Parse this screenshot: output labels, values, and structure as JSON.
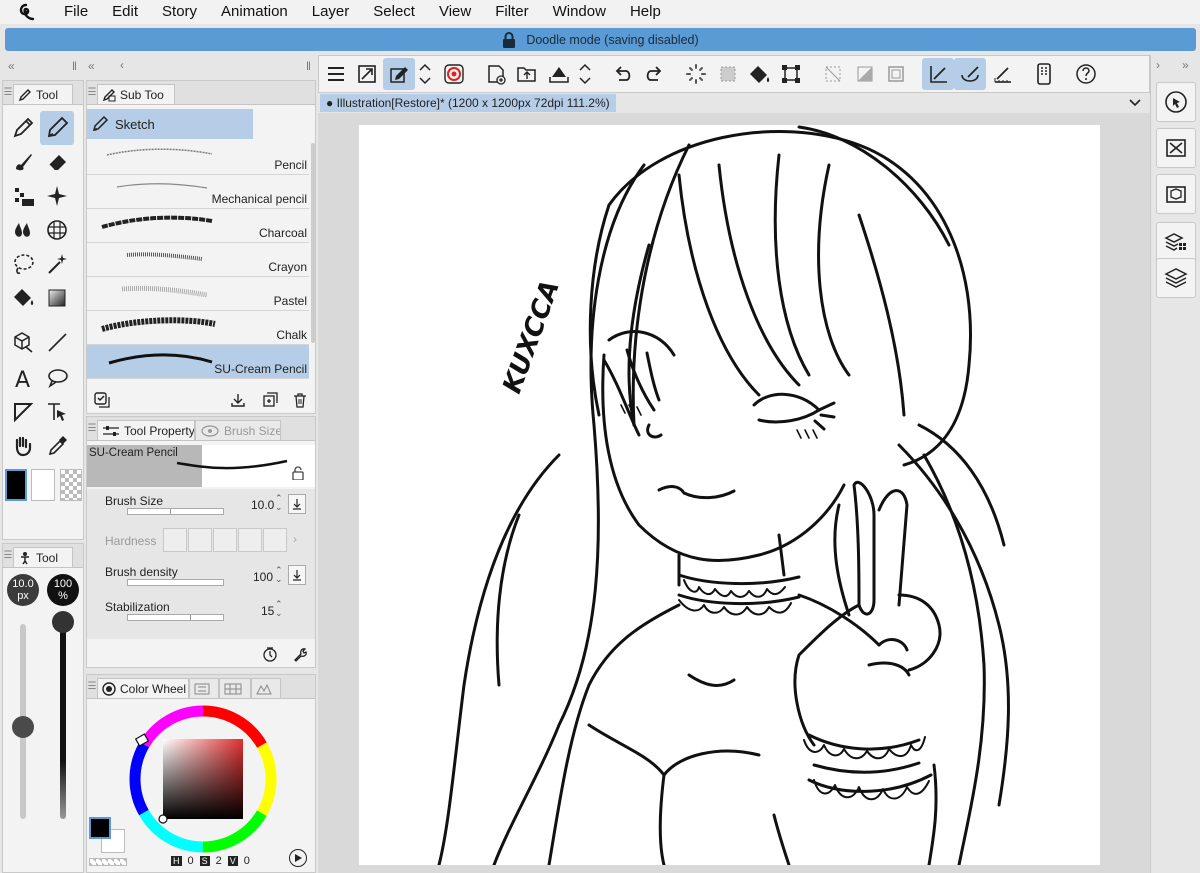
{
  "menu": [
    "File",
    "Edit",
    "Story",
    "Animation",
    "Layer",
    "Select",
    "View",
    "Filter",
    "Window",
    "Help"
  ],
  "banner": "Doodle mode (saving disabled)",
  "tool_panel": {
    "tab_label": "Tool"
  },
  "subtool_panel": {
    "tab_label": "Sub Too",
    "group": "Sketch",
    "brushes": [
      "Pencil",
      "Mechanical pencil",
      "Charcoal",
      "Crayon",
      "Pastel",
      "Chalk",
      "SU-Cream Pencil"
    ],
    "selected_brush": "SU-Cream Pencil"
  },
  "tool_property": {
    "tab_label": "Tool Property",
    "tab2_label": "Brush Size",
    "preview_name": "SU-Cream Pencil",
    "rows": [
      {
        "label": "Brush Size",
        "value": "10.0"
      },
      {
        "label": "Hardness",
        "value": ""
      },
      {
        "label": "Brush density",
        "value": "100"
      },
      {
        "label": "Stabilization",
        "value": "15"
      }
    ],
    "levels": {
      "brush_size": 0.2,
      "brush_density": 1.0,
      "stabilization": 0.15
    }
  },
  "brush_quick": {
    "tab_label": "Tool",
    "size_label": "10.0\npx",
    "size_value": "10.0",
    "size_unit": "px",
    "opacity_value": "100",
    "opacity_unit": "%"
  },
  "color_panel": {
    "tab_label": "Color Wheel",
    "hsv": [
      {
        "key": "H",
        "val": "0"
      },
      {
        "key": "S",
        "val": "2"
      },
      {
        "key": "V",
        "val": "0"
      }
    ],
    "main_color": "#000000",
    "sub_color": "#ffffff"
  },
  "canvas": {
    "tab_title": "Illustration[Restore]* (1200 x 1200px 72dpi 111.2%)",
    "signature": "KUXCCA"
  },
  "colors": {
    "accent": "#5b9bd5",
    "selected": "#b5cde6"
  }
}
